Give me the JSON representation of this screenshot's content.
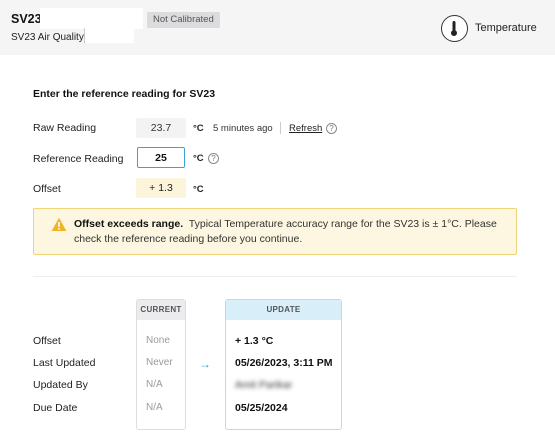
{
  "header": {
    "device_name": "SV23",
    "device_subtitle": "SV23 Air Quality",
    "badge": "Not Calibrated",
    "sensor_label": "Temperature",
    "sensor_icon": "thermometer-icon"
  },
  "form": {
    "title": "Enter the reference reading for SV23",
    "raw": {
      "label": "Raw Reading",
      "value": "23.7",
      "unit": "°C",
      "age": "5 minutes ago",
      "refresh": "Refresh"
    },
    "reference": {
      "label": "Reference Reading",
      "value": "25",
      "unit": "°C"
    },
    "offset": {
      "label": "Offset",
      "value": "+ 1.3",
      "unit": "°C"
    }
  },
  "warning": {
    "title": "Offset exceeds range.",
    "message": "Typical Temperature accuracy range for the SV23 is ± 1°C. Please check the reference reading before you continue.",
    "color": "#f0b429"
  },
  "comparison": {
    "current_header": "CURRENT",
    "update_header": "UPDATE",
    "rows": [
      {
        "label": "Offset",
        "current": "None",
        "update": "+ 1.3 °C"
      },
      {
        "label": "Last Updated",
        "current": "Never",
        "update": "05/26/2023, 3:11 PM"
      },
      {
        "label": "Updated By",
        "current": "N/A",
        "update": "Amit Parikar"
      },
      {
        "label": "Due Date",
        "current": "N/A",
        "update": "05/25/2024"
      }
    ]
  }
}
